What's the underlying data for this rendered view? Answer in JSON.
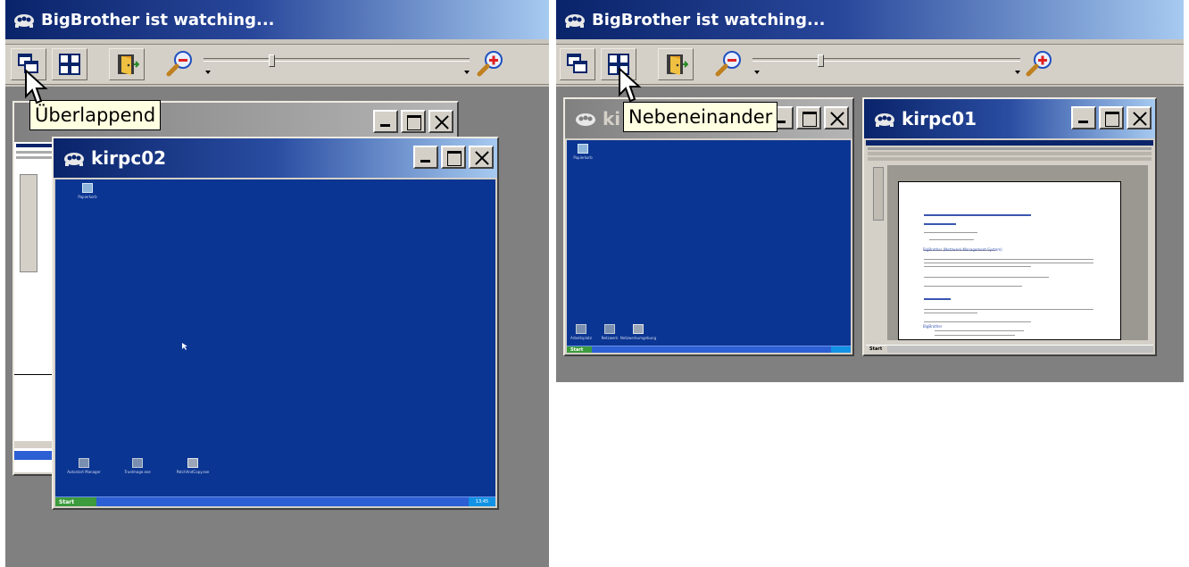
{
  "left_app": {
    "title": "BigBrother ist watching...",
    "toolbar": {
      "cascade_button": "cascade-windows",
      "tile_button": "tile-windows",
      "exit_button": "exit-door",
      "zoom_out": "zoom-out",
      "zoom_in": "zoom-in",
      "zoom_level": 0.25
    },
    "tooltip": "Überlappend",
    "back_window": {
      "title": ""
    },
    "front_window": {
      "title": "kirpc02",
      "desktop_icons": [
        "Papierkorb",
        "Autostart Manager",
        "TrueImage.exe",
        "PatchAndCopy.exe"
      ],
      "start_label": "Start",
      "clock": "13:45"
    }
  },
  "right_app": {
    "title": "BigBrother ist watching...",
    "tooltip": "Nebeneinander",
    "toolbar": {
      "zoom_level": 0.25
    },
    "left_window": {
      "title": "ki",
      "desktop_icons": [
        "Papierkorb",
        "Arbeitsplatz",
        "Netzwerk",
        "Netzwerkumgebung"
      ],
      "start_label": "Start"
    },
    "right_window": {
      "title": "kirpc01",
      "document_heading": "BigBrother (Netzwerk-Management-System)",
      "document_subheading": "BigBrother",
      "start_label": "Start"
    }
  },
  "colors": {
    "titlebar_dark": "#0a246a",
    "titlebar_light": "#a6caf0",
    "desktop_blue": "#0b3592",
    "tooltip_bg": "#ffffe1",
    "chrome": "#d4d0c8"
  }
}
